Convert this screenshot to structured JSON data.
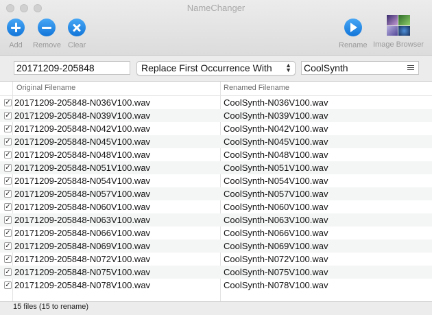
{
  "window": {
    "title": "NameChanger"
  },
  "toolbar": {
    "add_label": "Add",
    "remove_label": "Remove",
    "clear_label": "Clear",
    "rename_label": "Rename",
    "image_browser_label": "Image Browser"
  },
  "controls": {
    "find_value": "20171209-205848",
    "mode_selected": "Replace First Occurrence With",
    "replace_value": "CoolSynth"
  },
  "table": {
    "columns": [
      "Original Filename",
      "Renamed Filename"
    ],
    "rows": [
      {
        "checked": true,
        "original": "20171209-205848-N036V100.wav",
        "renamed": "CoolSynth-N036V100.wav"
      },
      {
        "checked": true,
        "original": "20171209-205848-N039V100.wav",
        "renamed": "CoolSynth-N039V100.wav"
      },
      {
        "checked": true,
        "original": "20171209-205848-N042V100.wav",
        "renamed": "CoolSynth-N042V100.wav"
      },
      {
        "checked": true,
        "original": "20171209-205848-N045V100.wav",
        "renamed": "CoolSynth-N045V100.wav"
      },
      {
        "checked": true,
        "original": "20171209-205848-N048V100.wav",
        "renamed": "CoolSynth-N048V100.wav"
      },
      {
        "checked": true,
        "original": "20171209-205848-N051V100.wav",
        "renamed": "CoolSynth-N051V100.wav"
      },
      {
        "checked": true,
        "original": "20171209-205848-N054V100.wav",
        "renamed": "CoolSynth-N054V100.wav"
      },
      {
        "checked": true,
        "original": "20171209-205848-N057V100.wav",
        "renamed": "CoolSynth-N057V100.wav"
      },
      {
        "checked": true,
        "original": "20171209-205848-N060V100.wav",
        "renamed": "CoolSynth-N060V100.wav"
      },
      {
        "checked": true,
        "original": "20171209-205848-N063V100.wav",
        "renamed": "CoolSynth-N063V100.wav"
      },
      {
        "checked": true,
        "original": "20171209-205848-N066V100.wav",
        "renamed": "CoolSynth-N066V100.wav"
      },
      {
        "checked": true,
        "original": "20171209-205848-N069V100.wav",
        "renamed": "CoolSynth-N069V100.wav"
      },
      {
        "checked": true,
        "original": "20171209-205848-N072V100.wav",
        "renamed": "CoolSynth-N072V100.wav"
      },
      {
        "checked": true,
        "original": "20171209-205848-N075V100.wav",
        "renamed": "CoolSynth-N075V100.wav"
      },
      {
        "checked": true,
        "original": "20171209-205848-N078V100.wav",
        "renamed": "CoolSynth-N078V100.wav"
      }
    ]
  },
  "status": {
    "text": "15 files (15 to rename)"
  },
  "icons": {
    "add": "plus-circle-icon",
    "remove": "minus-circle-icon",
    "clear": "x-circle-icon",
    "rename": "play-circle-icon",
    "image_browser": "photo-grid-icon"
  },
  "colors": {
    "accent": "#1a7fe0"
  }
}
